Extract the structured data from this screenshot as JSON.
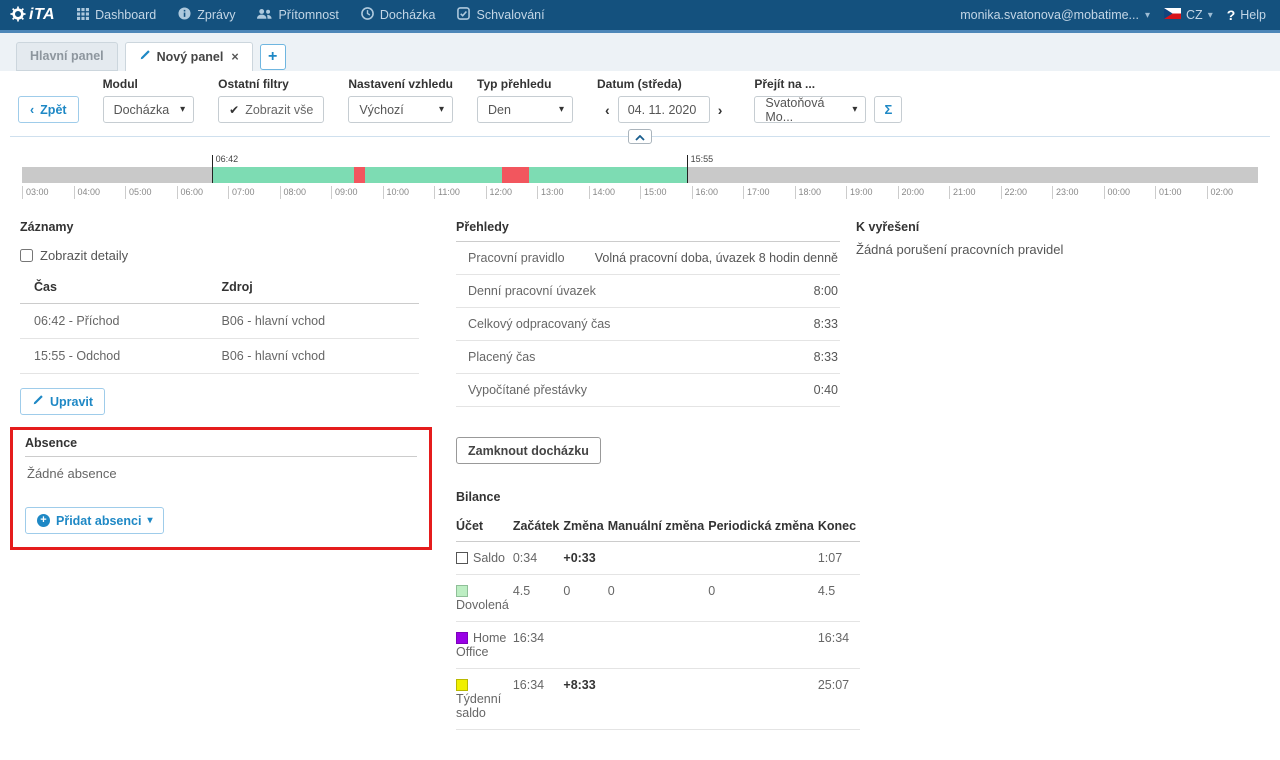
{
  "navbar": {
    "logo_text": "iTA",
    "items": [
      {
        "icon": "grid-icon",
        "label": "Dashboard"
      },
      {
        "icon": "info-icon",
        "label": "Zprávy"
      },
      {
        "icon": "users-icon",
        "label": "Přítomnost"
      },
      {
        "icon": "clock-icon",
        "label": "Docházka"
      },
      {
        "icon": "check-icon",
        "label": "Schvalování"
      }
    ],
    "user_email": "monika.svatonova@mobatime...",
    "language": "CZ",
    "help_icon": "?",
    "help_label": "Help",
    "caret_glyph": "▾"
  },
  "tabs": {
    "inactive_label": "Hlavní panel",
    "active_label": "Nový panel",
    "close_glyph": "×",
    "add_glyph": "+"
  },
  "toolbar": {
    "back_chevron": "‹",
    "back_label": "Zpět",
    "modul": {
      "label": "Modul",
      "value": "Docházka"
    },
    "filters": {
      "label": "Ostatní filtry",
      "check_glyph": "✔",
      "value": "Zobrazit vše"
    },
    "appearance": {
      "label": "Nastavení vzhledu",
      "value": "Výchozí"
    },
    "view_type": {
      "label": "Typ přehledu",
      "value": "Den"
    },
    "date": {
      "label": "Datum (středa)",
      "prev_glyph": "‹",
      "value": "04. 11. 2020",
      "next_glyph": "›"
    },
    "goto": {
      "label": "Přejít na ...",
      "value": "Svatoňová Mo..."
    },
    "sigma_label": "Σ",
    "caret_glyph": "▾"
  },
  "timeline": {
    "colors": {
      "idle": "#c9c9c9",
      "worked": "#7ddcb3",
      "break": "#f2565e"
    },
    "segments": [
      {
        "type": "worked",
        "start_pct": 15.34,
        "end_pct": 53.77
      },
      {
        "type": "break",
        "start_pct": 26.88,
        "end_pct": 27.73
      },
      {
        "type": "break",
        "start_pct": 38.87,
        "end_pct": 41.05
      }
    ],
    "markers": [
      {
        "label": "06:42",
        "pos_pct": 15.34
      },
      {
        "label": "15:55",
        "pos_pct": 53.77
      }
    ],
    "ticks": [
      "03:00",
      "04:00",
      "05:00",
      "06:00",
      "07:00",
      "08:00",
      "09:00",
      "10:00",
      "11:00",
      "12:00",
      "13:00",
      "14:00",
      "15:00",
      "16:00",
      "17:00",
      "18:00",
      "19:00",
      "20:00",
      "21:00",
      "22:00",
      "23:00",
      "00:00",
      "01:00",
      "02:00"
    ]
  },
  "records": {
    "title": "Záznamy",
    "show_details_label": "Zobrazit detaily",
    "columns": [
      "Čas",
      "Zdroj"
    ],
    "rows": [
      {
        "time": "06:42 - Příchod",
        "source": "B06 - hlavní vchod"
      },
      {
        "time": "15:55 - Odchod",
        "source": "B06 - hlavní vchod"
      }
    ],
    "edit_label": "Upravit"
  },
  "absence": {
    "title": "Absence",
    "empty_text": "Žádné absence",
    "add_label": "Přidat absenci",
    "annotation_color": "#e51c1c"
  },
  "overview": {
    "title": "Přehledy",
    "rows": [
      {
        "label": "Pracovní pravidlo",
        "value": "Volná pracovní doba, úvazek 8 hodin denně"
      },
      {
        "label": "Denní pracovní úvazek",
        "value": "8:00"
      },
      {
        "label": "Celkový odpracovaný čas",
        "value": "8:33"
      },
      {
        "label": "Placený čas",
        "value": "8:33"
      },
      {
        "label": "Vypočítané přestávky",
        "value": "0:40"
      }
    ],
    "lock_label": "Zamknout docházku"
  },
  "balance": {
    "title": "Bilance",
    "columns": [
      "Účet",
      "Začátek",
      "Změna",
      "Manuální změna",
      "Periodická změna",
      "Konec"
    ],
    "rows": [
      {
        "label": "Saldo",
        "swatch": "#ffffff",
        "swatch_border": "#555555",
        "start": "0:34",
        "change": "+0:33",
        "manual": "",
        "periodic": "",
        "end": "1:07"
      },
      {
        "label": "Dovolená",
        "swatch": "#bdeec3",
        "swatch_border": "#8fbf98",
        "start": "4.5",
        "change": "0",
        "manual": "0",
        "periodic": "0",
        "end": "4.5"
      },
      {
        "label": "Home Office",
        "swatch": "#9900e6",
        "swatch_border": "#7d00bb",
        "start": "16:34",
        "change": "",
        "manual": "",
        "periodic": "",
        "end": "16:34"
      },
      {
        "label": "Týdenní saldo",
        "swatch": "#f0f000",
        "swatch_border": "#b9b900",
        "start": "16:34",
        "change": "+8:33",
        "manual": "",
        "periodic": "",
        "end": "25:07"
      }
    ]
  },
  "issues": {
    "title": "K vyřešení",
    "text": "Žádná porušení pracovních pravidel"
  }
}
